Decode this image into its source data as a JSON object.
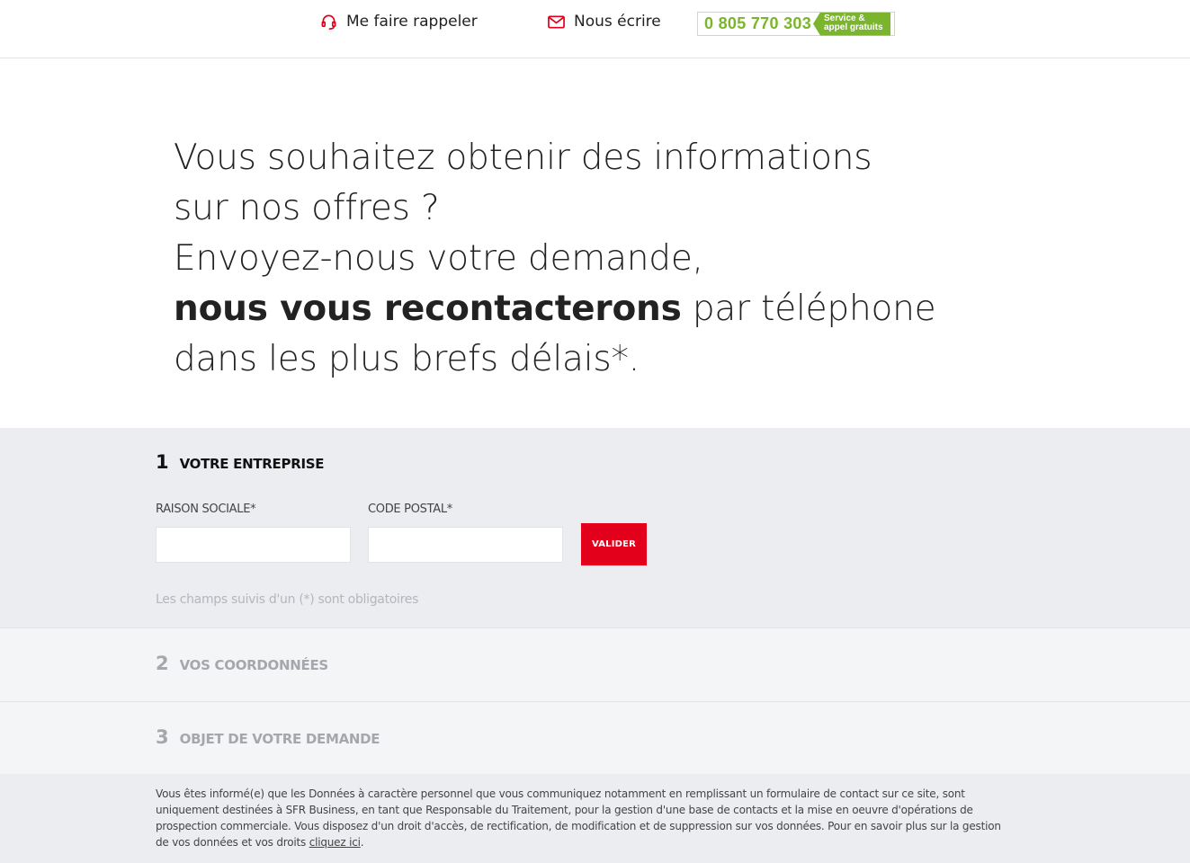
{
  "topbar": {
    "callback_label": "Me faire rappeler",
    "write_label": "Nous écrire",
    "phone_number": "0 805 770 303",
    "phone_tag_line1": "Service &",
    "phone_tag_line2": "appel gratuits",
    "accent_color": "#e2001a",
    "phone_color": "#7ab52d"
  },
  "hero": {
    "line1": "Vous souhaitez obtenir des informations",
    "line2": "sur nos offres ?",
    "line3": "Envoyez-nous votre demande,",
    "line4_bold": "nous vous recontacterons",
    "line4_rest": " par téléphone",
    "line5": "dans les plus brefs délais*."
  },
  "step1": {
    "number": "1",
    "title": "VOTRE ENTREPRISE",
    "raison_label": "RAISON SOCIALE*",
    "raison_value": "",
    "cp_label": "CODE POSTAL*",
    "cp_value": "",
    "submit_label": "VALIDER",
    "required_note": "Les champs suivis d'un (*) sont obligatoires"
  },
  "step2": {
    "number": "2",
    "title": "VOS COORDONNÉES"
  },
  "step3": {
    "number": "3",
    "title": "OBJET DE VOTRE DEMANDE"
  },
  "legal": {
    "text": "Vous êtes informé(e) que les Données à caractère personnel que vous communiquez notamment en remplissant un formulaire de contact sur ce site, sont uniquement destinées à SFR Business, en tant que Responsable du Traitement, pour la gestion d'une base de contacts et la mise en oeuvre d'opérations de prospection commerciale. Vous disposez d'un droit d'accès, de rectification, de modification et de suppression sur vos données. Pour en savoir plus sur la gestion de vos données et vos droits ",
    "link_label": "cliquez ici",
    "end": "."
  }
}
